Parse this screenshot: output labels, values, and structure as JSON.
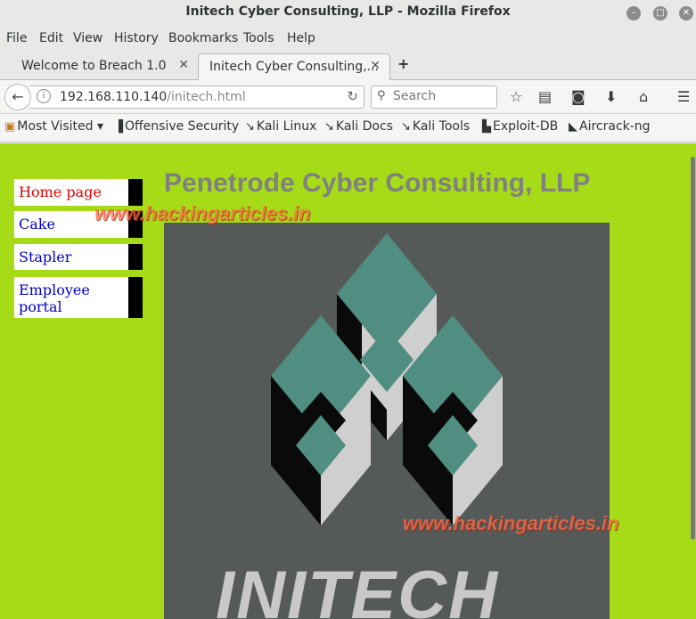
{
  "window": {
    "title": "Initech Cyber Consulting, LLP - Mozilla Firefox"
  },
  "menu": [
    "File",
    "Edit",
    "View",
    "History",
    "Bookmarks",
    "Tools",
    "Help"
  ],
  "tabs": [
    {
      "label": "Welcome to Breach 1.0",
      "active": false
    },
    {
      "label": "Initech Cyber Consulting,...",
      "active": true
    }
  ],
  "urlbar": {
    "host": "192.168.110.140",
    "path": "/initech.html"
  },
  "search": {
    "placeholder": "Search"
  },
  "bookmarks": [
    "Most Visited ▾",
    "Offensive Security",
    "Kali Linux",
    "Kali Docs",
    "Kali Tools",
    "Exploit-DB",
    "Aircrack-ng"
  ],
  "page": {
    "heading": "Penetrode Cyber Consulting, LLP",
    "nav": [
      "Home page",
      "Cake",
      "Stapler",
      "Employee portal"
    ],
    "logo_text": "INITECH",
    "watermark": "www.hackingarticles.in"
  },
  "colors": {
    "page_bg": "#a6dc17",
    "logo_bg": "#555a58",
    "logo_teal": "#4f8e80",
    "link": "#0000c8",
    "link_current": "#e00000"
  },
  "icons": [
    "info-icon",
    "reload-icon",
    "search-icon",
    "star-icon",
    "reading-list-icon",
    "pocket-icon",
    "download-icon",
    "home-icon",
    "hamburger-menu-icon"
  ]
}
